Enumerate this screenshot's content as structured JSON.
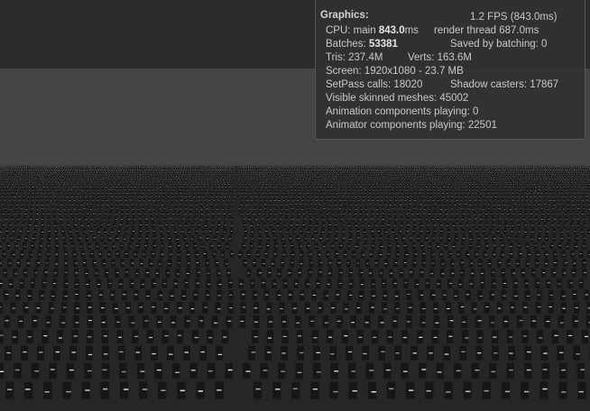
{
  "stats": {
    "header": "Graphics:",
    "fps": "1.2 FPS (843.0ms)",
    "cpu_label": "CPU: main",
    "cpu_main": "843.0",
    "cpu_unit": "ms",
    "render_thread": "render thread 687.0ms",
    "batches_label": "Batches:",
    "batches": "53381",
    "saved_by_batching": "Saved by batching: 0",
    "tris": "Tris: 237.4M",
    "verts": "Verts: 163.6M",
    "screen": "Screen: 1920x1080 - 23.7 MB",
    "setpass": "SetPass calls: 18020",
    "shadow_casters": "Shadow casters: 17867",
    "visible_skinned": "Visible skinned meshes: 45002",
    "animation_components": "Animation components playing: 0",
    "animator_components": "Animator components playing: 22501"
  },
  "colors": {
    "toolbar": "#2c2c2c",
    "viewport_bg": "#454545",
    "ground": "#262626",
    "crowd_dark": "#161616",
    "crowd_highlight": "#e8e8e8"
  }
}
